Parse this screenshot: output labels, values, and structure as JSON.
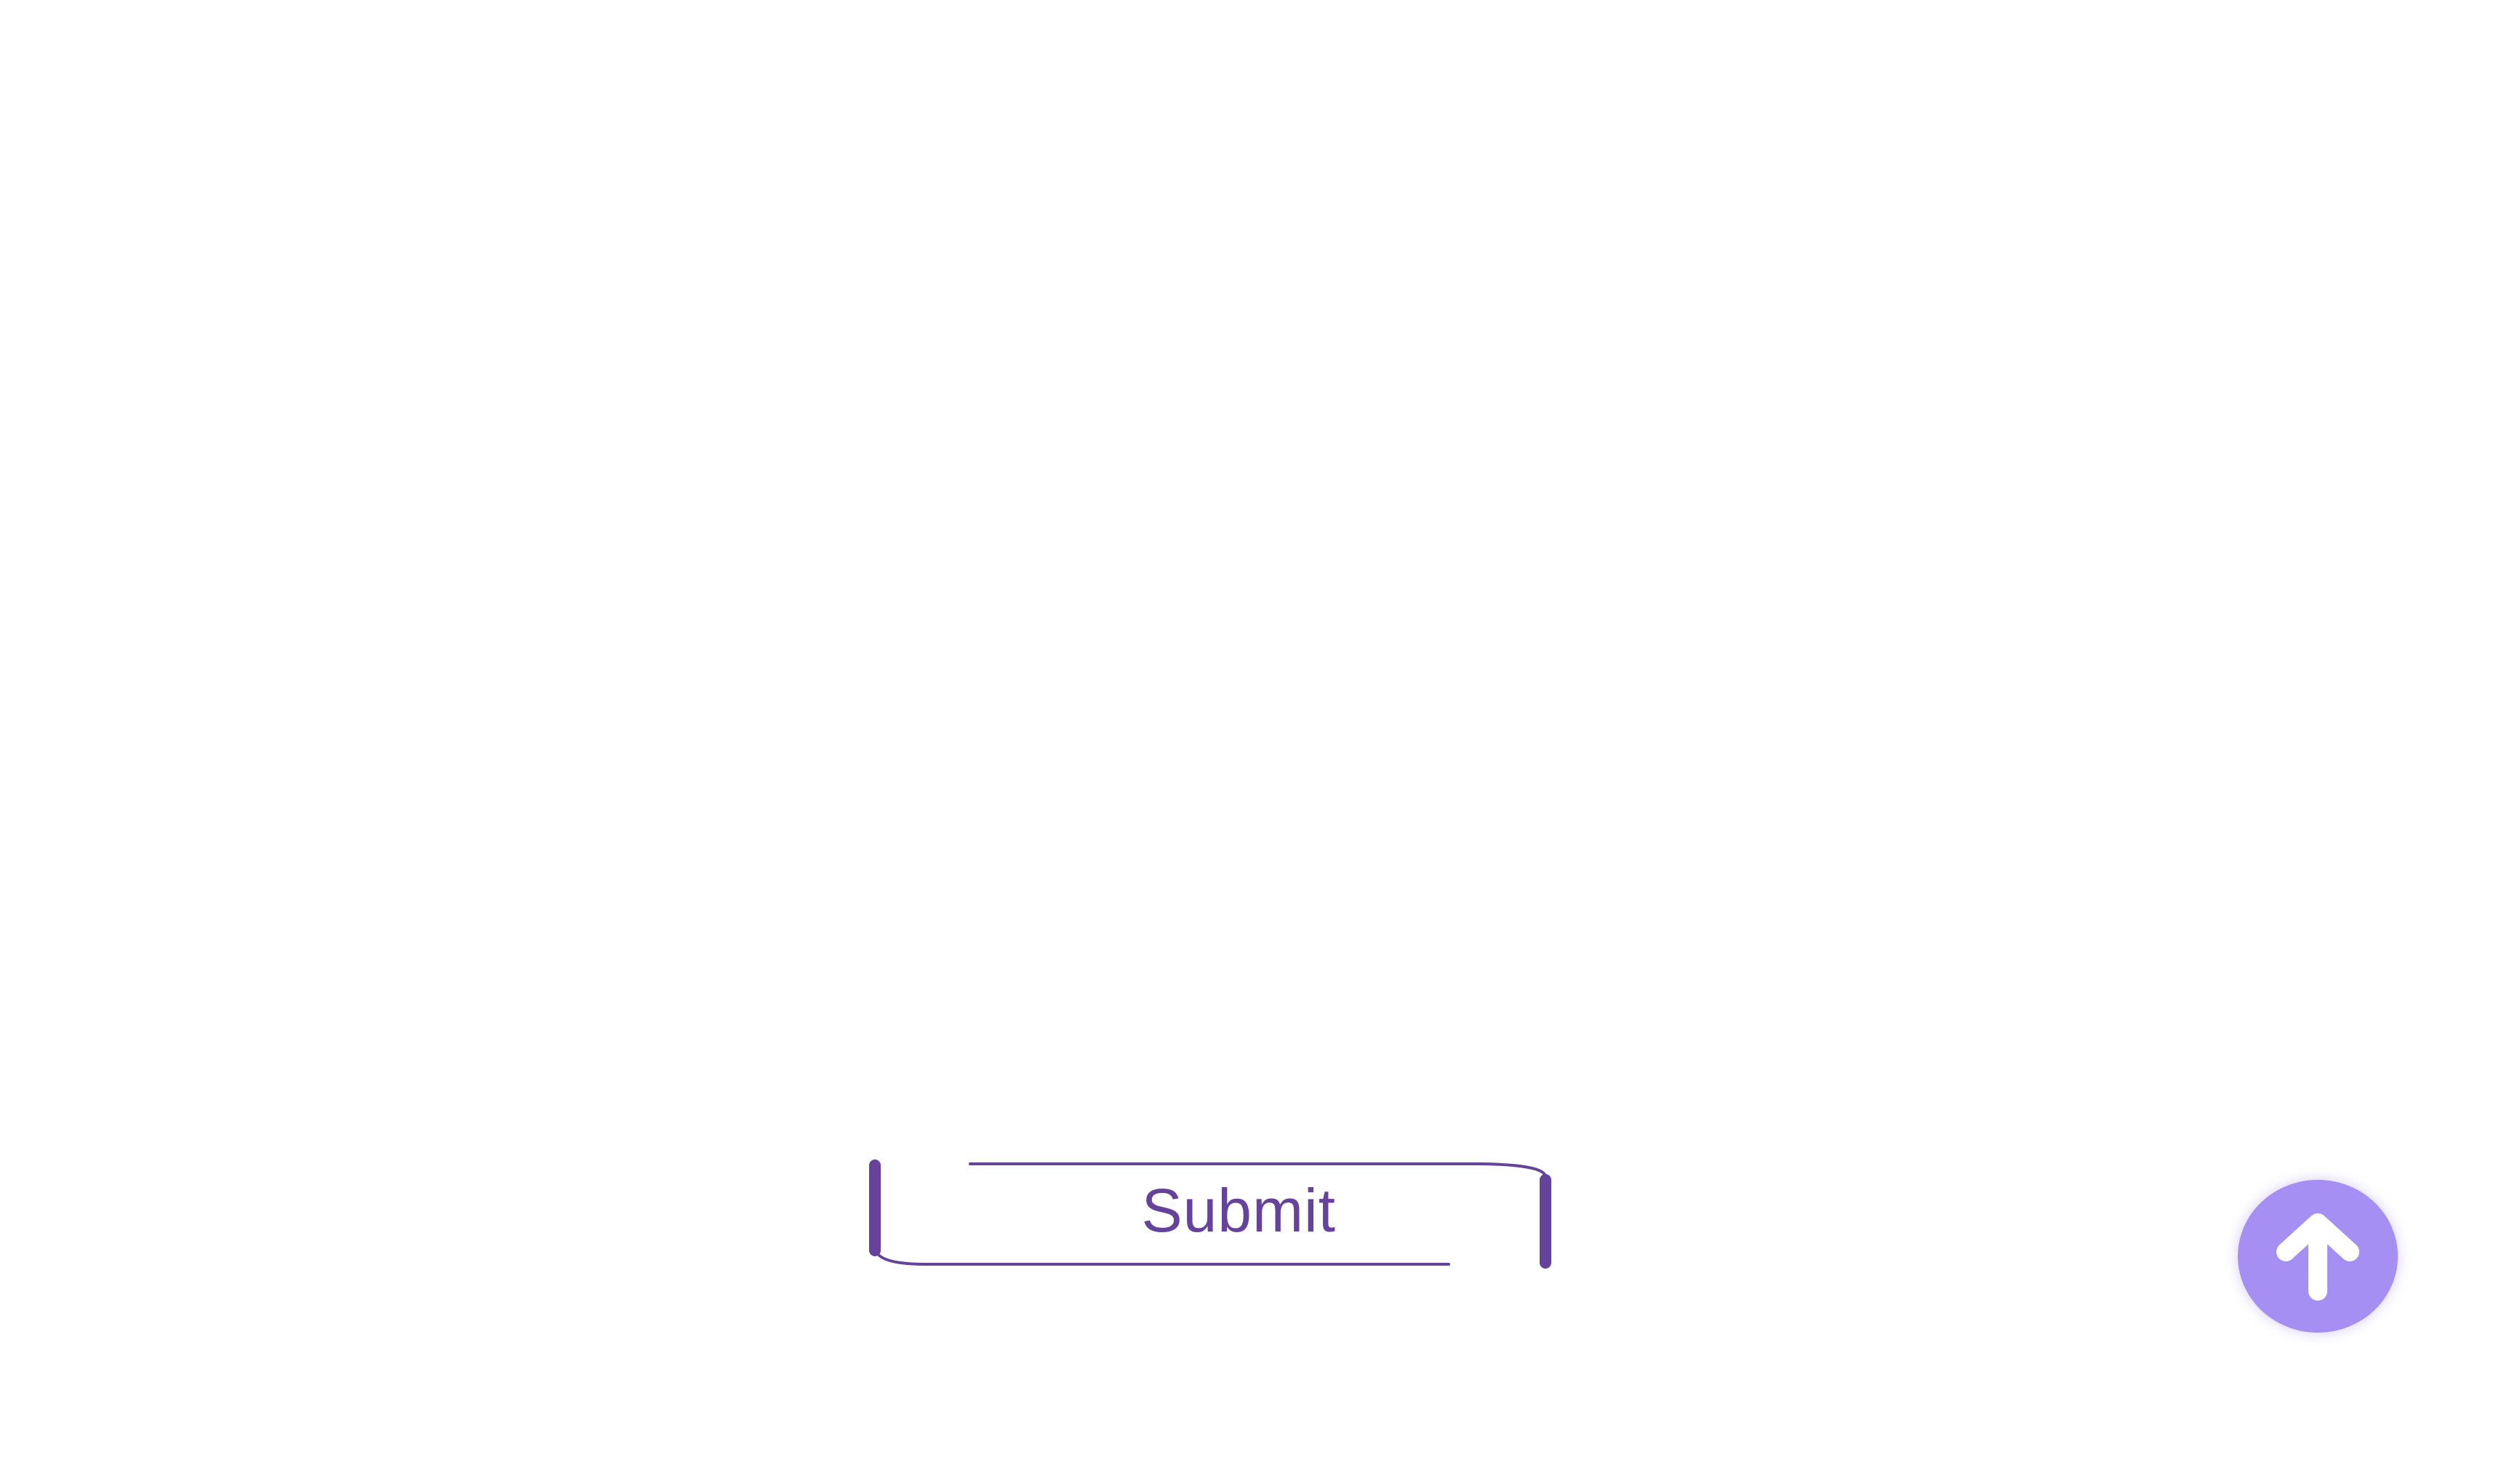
{
  "form": {
    "submit_label": "Submit"
  },
  "icons": {
    "scroll_top": "arrow-up-icon"
  },
  "colors": {
    "accent": "#65439a",
    "fab_background": "#a68ff3",
    "background": "#ffffff"
  }
}
